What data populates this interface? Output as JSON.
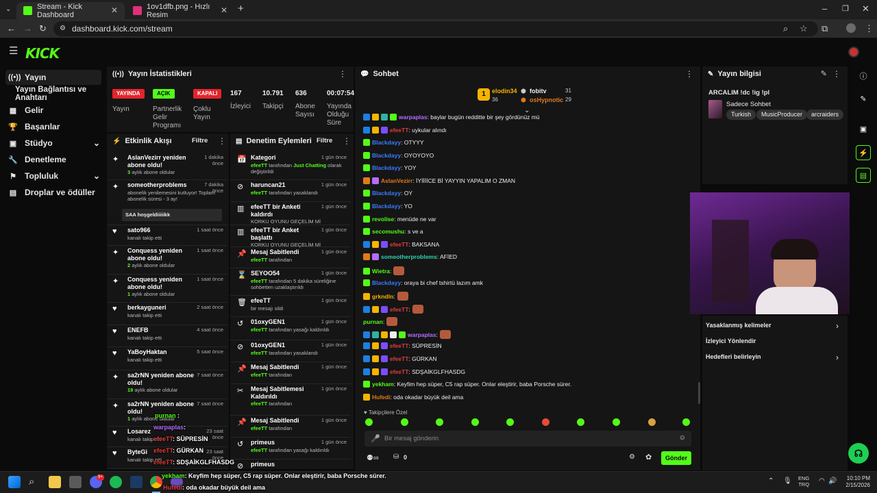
{
  "browser": {
    "tabs": [
      {
        "title": "Stream - Kick Dashboard"
      },
      {
        "title": "1ov1dfb.png - Hızlı Resim"
      }
    ],
    "url": "dashboard.kick.com/stream"
  },
  "sidebar": {
    "items": [
      {
        "label": "Yayın"
      },
      {
        "label": "Yayın Bağlantısı ve Anahtarı"
      },
      {
        "label": "Gelir"
      },
      {
        "label": "Başarılar"
      },
      {
        "label": "Stüdyo"
      },
      {
        "label": "Denetleme"
      },
      {
        "label": "Topluluk"
      },
      {
        "label": "Droplar ve ödüller"
      }
    ]
  },
  "stats": {
    "title": "Yayın İstatistikleri",
    "badges": [
      {
        "value": "YAYINDA",
        "label": "Yayın",
        "color": "#e4242b"
      },
      {
        "value": "AÇIK",
        "label": "Partnerlik Gelir Programı",
        "color": "#53fc18"
      },
      {
        "value": "KAPALI",
        "label": "Çoklu Yayın",
        "color": "#e4242b"
      }
    ],
    "numbers": [
      {
        "value": "167",
        "label": "İzleyici"
      },
      {
        "value": "10.791",
        "label": "Takipçi"
      },
      {
        "value": "636",
        "label": "Abone Sayısı"
      },
      {
        "value": "00:07:54",
        "label": "Yayında Olduğu Süre"
      }
    ]
  },
  "activity": {
    "title": "Etkinlik Akışı",
    "filter": "Filtre",
    "rows": [
      {
        "icon": "sub",
        "title": "AslanVezirr yeniden abone oldu!",
        "sub_n": "3",
        "sub_t": " aylık abone oldular",
        "time": "1 dakika önce"
      },
      {
        "icon": "sub",
        "title": "someotherproblems",
        "sub_n": "",
        "sub_t": "abonelik yenilemesini kutluyor! Toplam abonelik süresi - 3 ay!",
        "time": "7 dakika önce",
        "note": "SAA hoşgeldiiiiikk"
      },
      {
        "icon": "heart",
        "title": "sato966",
        "sub_n": "",
        "sub_t": "kanalı takip etti",
        "time": "1 saat önce"
      },
      {
        "icon": "sub",
        "title": "Conquess yeniden abone oldu!",
        "sub_n": "2",
        "sub_t": " aylık abone oldular",
        "time": "1 saat önce"
      },
      {
        "icon": "sub",
        "title": "Conquess yeniden abone oldu!",
        "sub_n": "1",
        "sub_t": " aylık abone oldular",
        "time": "1 saat önce"
      },
      {
        "icon": "heart",
        "title": "berkayguneri",
        "sub_n": "",
        "sub_t": "kanalı takip etti",
        "time": "2 saat önce"
      },
      {
        "icon": "heart",
        "title": "ENEFB",
        "sub_n": "",
        "sub_t": "kanalı takip etti",
        "time": "4 saat önce"
      },
      {
        "icon": "heart",
        "title": "YaBoyHaktan",
        "sub_n": "",
        "sub_t": "kanalı takip etti",
        "time": "5 saat önce"
      },
      {
        "icon": "sub",
        "title": "sa2rNN yeniden abone oldu!",
        "sub_n": "19",
        "sub_t": " aylık abone oldular",
        "time": "7 saat önce"
      },
      {
        "icon": "sub",
        "title": "sa2rNN yeniden abone oldu!",
        "sub_n": "1",
        "sub_t": " aylık abone oldular",
        "time": "7 saat önce"
      },
      {
        "icon": "heart",
        "title": "Losarez",
        "sub_n": "",
        "sub_t": "kanalı takip etti",
        "time": "23 saat önce"
      },
      {
        "icon": "heart",
        "title": "ByteGi",
        "sub_n": "",
        "sub_t": "kanalı takip etti",
        "time": "23 saat önce"
      }
    ]
  },
  "moderation": {
    "title": "Denetim Eylemleri",
    "filter": "Filtre",
    "rows": [
      {
        "icon": "📅",
        "title": "Kategori",
        "by": "efeeTT",
        "mid": " tarafından ",
        "hl": "Just Chatting",
        "rest": " olarak değiştirildi",
        "time": "1 gün önce"
      },
      {
        "icon": "⊘",
        "title": "haruncan21",
        "by": "efeeTT",
        "mid": " tarafından yasaklandı",
        "hl": "",
        "rest": "",
        "time": "1 gün önce"
      },
      {
        "icon": "▥",
        "title": "efeeTT bir Anketi kaldırdı",
        "by": "",
        "mid": "KORKU OYUNU GEÇELİM Mİ",
        "hl": "",
        "rest": "",
        "time": "1 gün önce"
      },
      {
        "icon": "▥",
        "title": "efeeTT bir Anket başlattı",
        "by": "",
        "mid": "KORKU OYUNU GEÇELİM Mİ",
        "hl": "",
        "rest": "",
        "time": "1 gün önce"
      },
      {
        "icon": "📌",
        "title": "Mesaj Sabitlendi",
        "by": "efeeTT",
        "mid": " tarafından",
        "hl": "",
        "rest": "",
        "time": "1 gün önce"
      },
      {
        "icon": "⌛",
        "title": "SEYOO54",
        "by": "efeeTT",
        "mid": " tarafından 5 dakika süreliğine sohbetten uzaklaştırıldı",
        "hl": "",
        "rest": "",
        "time": "1 gün önce"
      },
      {
        "icon": "🗑",
        "title": "efeeTT",
        "by": "",
        "mid": "bir mesajı sildi",
        "hl": "",
        "rest": "",
        "time": "1 gün önce"
      },
      {
        "icon": "↺",
        "title": "01oxyGEN1",
        "by": "efeeTT",
        "mid": " tarafından yasağı kaldırıldı",
        "hl": "",
        "rest": "",
        "time": "1 gün önce"
      },
      {
        "icon": "⊘",
        "title": "01oxyGEN1",
        "by": "efeeTT",
        "mid": " tarafından yasaklandı",
        "hl": "",
        "rest": "",
        "time": "1 gün önce"
      },
      {
        "icon": "📌",
        "title": "Mesaj Sabitlendi",
        "by": "efeeTT",
        "mid": " tarafından",
        "hl": "",
        "rest": "",
        "time": "1 gün önce"
      },
      {
        "icon": "✂",
        "title": "Mesaj Sabitlemesi Kaldırıldı",
        "by": "efeeTT",
        "mid": " tarafından",
        "hl": "",
        "rest": "",
        "time": "1 gün önce"
      },
      {
        "icon": "📌",
        "title": "Mesaj Sabitlendi",
        "by": "efeeTT",
        "mid": " tarafından",
        "hl": "",
        "rest": "",
        "time": "1 gün önce"
      },
      {
        "icon": "↺",
        "title": "primeus",
        "by": "efeeTT",
        "mid": " tarafından yasağı kaldırıldı",
        "hl": "",
        "rest": "",
        "time": "1 gün önce"
      },
      {
        "icon": "⊘",
        "title": "primeus",
        "by": "",
        "mid": "",
        "hl": "",
        "rest": "",
        "time": ""
      }
    ]
  },
  "chat": {
    "title": "Sohbet",
    "leaders": [
      {
        "name": "elodin34",
        "count": "36"
      },
      {
        "name": "fobitv",
        "count": "31"
      },
      {
        "name": "osHypnotic",
        "count": "29"
      }
    ],
    "messages": [
      {
        "badges": [
          "#1d7fe0",
          "#f5b400",
          "#2fb1a3",
          "#53fc18"
        ],
        "user": "warpaplas",
        "color": "#b46cff",
        "text": ": baylar bugün redditte bir şey gördünüz mü"
      },
      {
        "badges": [
          "#1d7fe0",
          "#f5b400",
          "#7b4dff"
        ],
        "user": "efeeTT",
        "color": "#e23c3c",
        "text": ": uykular alındı"
      },
      {
        "badges": [
          "#53fc18"
        ],
        "user": "Blackdayy",
        "color": "#3b7bff",
        "text": ": OTYYY"
      },
      {
        "badges": [
          "#53fc18"
        ],
        "user": "Blackdayy",
        "color": "#3b7bff",
        "text": ": OYOYOYO"
      },
      {
        "badges": [
          "#53fc18"
        ],
        "user": "Blackdayy",
        "color": "#3b7bff",
        "text": ": YOY"
      },
      {
        "badges": [
          "#e07a1d",
          "#b46cff"
        ],
        "user": "AslanVezirr",
        "color": "#e07a1d",
        "text": ": İYİİİİCE Bİ YAYYIN YAPALIM O ZMAN"
      },
      {
        "badges": [
          "#53fc18"
        ],
        "user": "Blackdayy",
        "color": "#3b7bff",
        "text": ": OY"
      },
      {
        "badges": [
          "#53fc18"
        ],
        "user": "Blackdayy",
        "color": "#3b7bff",
        "text": ": YO"
      },
      {
        "badges": [
          "#53fc18"
        ],
        "user": "revolise",
        "color": "#53fc18",
        "text": ": menüde ne var"
      },
      {
        "badges": [
          "#53fc18"
        ],
        "user": "secomushu",
        "color": "#53fc18",
        "text": ": s ve a"
      },
      {
        "badges": [
          "#1d7fe0",
          "#f5b400",
          "#7b4dff"
        ],
        "user": "efeeTT",
        "color": "#e23c3c",
        "text": ": BAKSANA"
      },
      {
        "badges": [
          "#e07a1d",
          "#b46cff"
        ],
        "user": "someotherproblems",
        "color": "#2fd3b0",
        "text": ": AFİED"
      },
      {
        "badges": [
          "#53fc18"
        ],
        "user": "Wietra",
        "color": "#53fc18",
        "text": ":",
        "emote": true
      },
      {
        "badges": [
          "#53fc18"
        ],
        "user": "Blackdayy",
        "color": "#3b7bff",
        "text": ": oraya bi chef tshirtü lazım amk"
      },
      {
        "badges": [
          "#f5b400"
        ],
        "user": "grkndln",
        "color": "#f5b400",
        "text": ":",
        "emote": true
      },
      {
        "badges": [
          "#1d7fe0",
          "#f5b400",
          "#7b4dff"
        ],
        "user": "efeeTT",
        "color": "#e23c3c",
        "text": ":",
        "emote": true
      },
      {
        "badges": [],
        "user": "purnan",
        "color": "#53fc18",
        "text": ":",
        "emote": true
      },
      {
        "badges": [
          "#1d7fe0",
          "#2fb1a3",
          "#f5b400",
          "#eee",
          "#53fc18"
        ],
        "user": "warpaplas",
        "color": "#b46cff",
        "text": ":",
        "emote": true
      },
      {
        "badges": [
          "#1d7fe0",
          "#f5b400",
          "#7b4dff"
        ],
        "user": "efeeTT",
        "color": "#e23c3c",
        "text": ": SÜPRESİN"
      },
      {
        "badges": [
          "#1d7fe0",
          "#f5b400",
          "#7b4dff"
        ],
        "user": "efeeTT",
        "color": "#e23c3c",
        "text": ": GÜRKAN"
      },
      {
        "badges": [
          "#1d7fe0",
          "#f5b400",
          "#7b4dff"
        ],
        "user": "efeeTT",
        "color": "#e23c3c",
        "text": ": SDŞAİKGLFHASDG"
      },
      {
        "badges": [
          "#53fc18"
        ],
        "user": "yekham",
        "color": "#53fc18",
        "text": ": Keyfim hep süper, C5 rap süper. Onlar eleştirir, baba Porsche sürer."
      },
      {
        "badges": [
          "#f5b400"
        ],
        "user": "Hufedi",
        "color": "#e07a1d",
        "text": ": oda okadar büyük deil ama"
      }
    ],
    "follower_only": "Takipçilere Özel",
    "placeholder": "Bir mesaj gönderin",
    "points": "0",
    "send": "Gönder"
  },
  "info": {
    "title": "Yayın bilgisi",
    "stream_title": "ARCALIM !dc !ig !pl",
    "category": "Sadece Sohbet",
    "tags": [
      "Turkish",
      "MusicProducer",
      "arcraiders"
    ],
    "links": [
      {
        "label": "Yasaklanmış kelimeler"
      },
      {
        "label": "İzleyici Yönlendir"
      },
      {
        "label": "Hedefleri belirleyin"
      }
    ]
  },
  "overlay": {
    "lines": [
      {
        "user": "purnan",
        "color": "#53fc18",
        "text": " :"
      },
      {
        "user": "warpaplas",
        "color": "#b46cff",
        "text": ":"
      },
      {
        "user": "efeeTT",
        "color": "#e23c3c",
        "text": ": SÜPRESİN"
      },
      {
        "user": "efeeTT",
        "color": "#e23c3c",
        "text": ": GÜRKAN"
      },
      {
        "user": "efeeTT",
        "color": "#e23c3c",
        "text": ": SDŞAİKGLFHASDG"
      }
    ],
    "caption1_user": "yekham",
    "caption1_text": ": Keyfim hep süper, C5 rap süper. Onlar eleştirir, baba Porsche sürer.",
    "caption2_user": "Hufedi",
    "caption2_text": ": oda okadar büyük deil ama"
  },
  "taskbar": {
    "lang1": "ENG",
    "lang2": "TRQ",
    "time": "10:10 PM",
    "date": "2/15/2026",
    "discord_badge": "9+"
  }
}
